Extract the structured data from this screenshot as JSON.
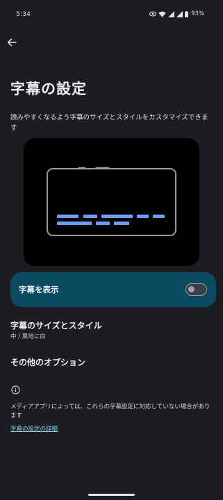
{
  "status_bar": {
    "time": "5:34",
    "battery": "93%",
    "icons": [
      "eye-icon",
      "wifi-icon",
      "signal-icon",
      "signal-icon",
      "battery-icon"
    ]
  },
  "header": {
    "back_icon": "arrow-left-icon",
    "title": "字幕の設定"
  },
  "description": "読みやすくなるよう字幕のサイズとスタイルをカスタマイズできます",
  "preview": {
    "icon": "captions-preview-illustration",
    "accent_color": "#6f9cf5"
  },
  "toggle": {
    "label": "字幕を表示",
    "enabled": false
  },
  "settings": {
    "size_style_title": "字幕のサイズとスタイル",
    "size_style_value": "中 / 黒地に白",
    "more_options_title": "その他のオプション"
  },
  "footer": {
    "info_icon": "info-icon",
    "note": "メディアアプリによっては、これらの字幕設定に対応していない場合があります",
    "link": "字幕の設定の詳細"
  },
  "colors": {
    "background": "#1b1d21",
    "toggle_card": "#0b4a60",
    "link": "#8fd0f0"
  }
}
